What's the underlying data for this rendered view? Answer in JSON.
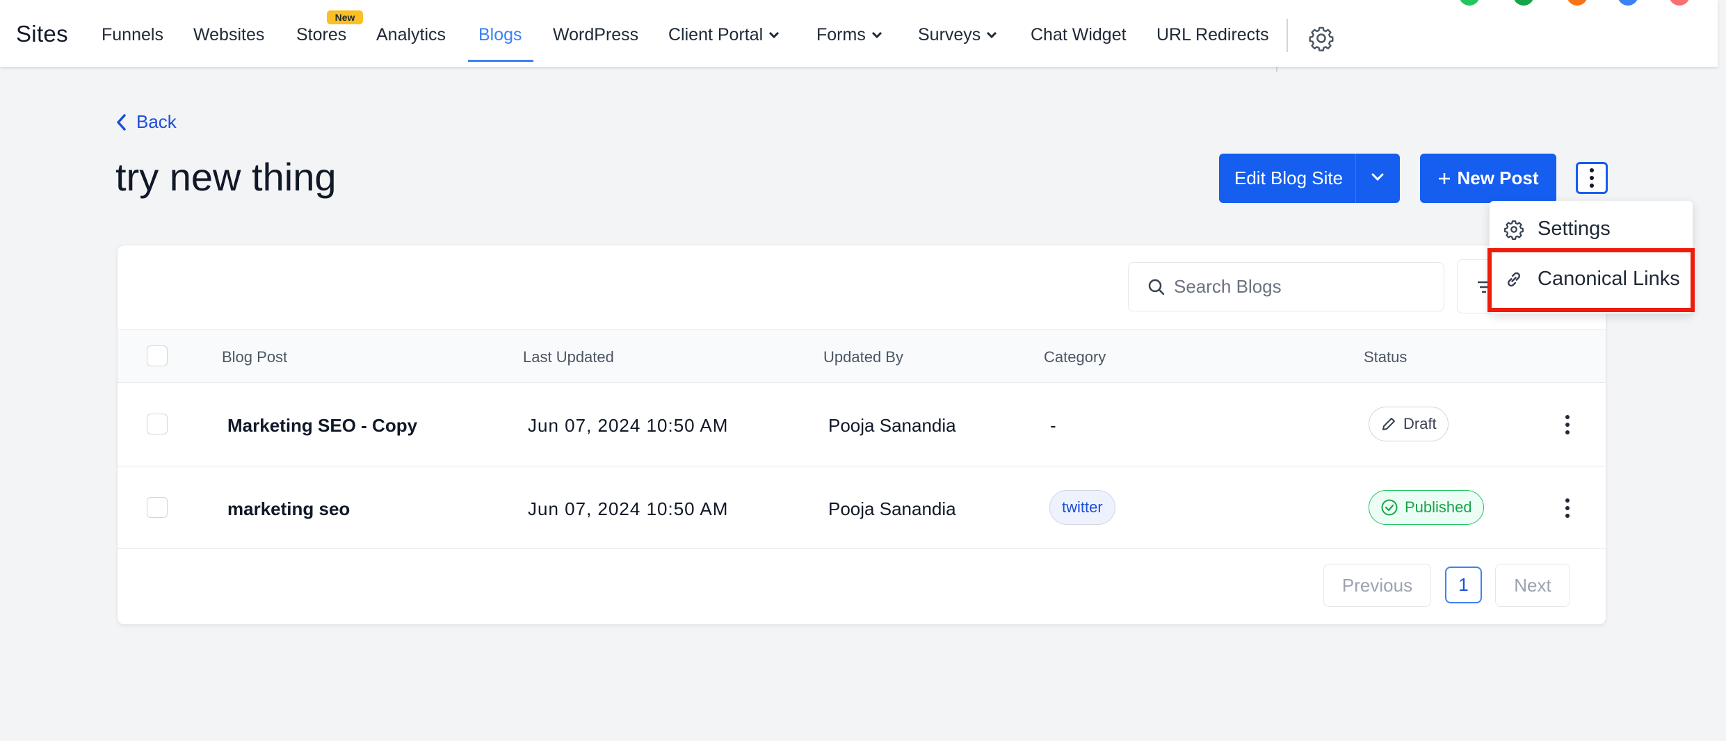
{
  "nav": {
    "brand": "Sites",
    "items": [
      "Funnels",
      "Websites",
      "Stores",
      "Analytics",
      "Blogs",
      "WordPress",
      "Client Portal",
      "Forms",
      "Surveys",
      "Chat Widget",
      "URL Redirects"
    ],
    "new_badge": "New",
    "active": "Blogs"
  },
  "header": {
    "back_label": "Back",
    "title": "try new thing",
    "edit_button": "Edit Blog Site",
    "new_post_button": "New Post"
  },
  "menu": {
    "items": [
      "Settings",
      "Canonical Links"
    ],
    "highlighted": "Canonical Links"
  },
  "search": {
    "placeholder": "Search Blogs"
  },
  "table": {
    "columns": [
      "Blog Post",
      "Last Updated",
      "Updated By",
      "Category",
      "Status"
    ],
    "rows": [
      {
        "post": "Marketing SEO - Copy",
        "updated": "Jun 07, 2024 10:50 AM",
        "by": "Pooja Sanandia",
        "category": "-",
        "status": "Draft"
      },
      {
        "post": "marketing seo",
        "updated": "Jun 07, 2024 10:50 AM",
        "by": "Pooja Sanandia",
        "category": "twitter",
        "status": "Published"
      }
    ]
  },
  "pagination": {
    "previous": "Previous",
    "current": "1",
    "next": "Next"
  },
  "colors": {
    "primary": "#155eef",
    "active_nav": "#3b82f6",
    "published": "#16a34a",
    "highlight": "#ef1b0b"
  }
}
